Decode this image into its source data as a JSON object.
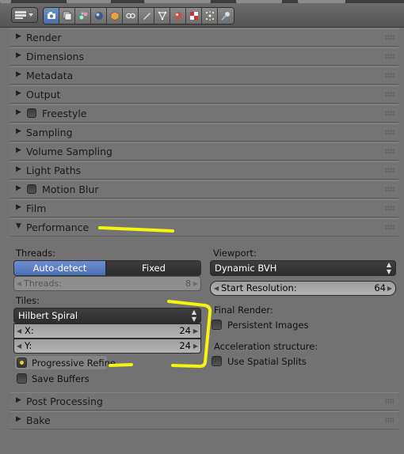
{
  "header": {
    "editor_type_icon": "properties-editor-icon",
    "context_tabs": [
      {
        "icon": "render-icon",
        "active": true
      },
      {
        "icon": "render-layers-icon",
        "active": false
      },
      {
        "icon": "scene-icon",
        "active": false
      },
      {
        "icon": "world-icon",
        "active": false
      },
      {
        "icon": "object-icon",
        "active": false
      },
      {
        "icon": "constraints-icon",
        "active": false
      },
      {
        "icon": "modifiers-icon",
        "active": false
      },
      {
        "icon": "object-data-icon",
        "active": false
      },
      {
        "icon": "material-icon",
        "active": false
      },
      {
        "icon": "texture-icon",
        "active": false
      },
      {
        "icon": "particles-icon",
        "active": false
      },
      {
        "icon": "physics-icon",
        "active": false
      }
    ]
  },
  "panels_top": [
    {
      "title": "Render",
      "checkbox": false
    },
    {
      "title": "Dimensions",
      "checkbox": false
    },
    {
      "title": "Metadata",
      "checkbox": false
    },
    {
      "title": "Output",
      "checkbox": false
    },
    {
      "title": "Freestyle",
      "checkbox": true
    },
    {
      "title": "Sampling",
      "checkbox": false
    },
    {
      "title": "Volume Sampling",
      "checkbox": false
    },
    {
      "title": "Light Paths",
      "checkbox": false
    },
    {
      "title": "Motion Blur",
      "checkbox": true
    },
    {
      "title": "Film",
      "checkbox": false
    }
  ],
  "performance": {
    "title": "Performance",
    "threads_label": "Threads:",
    "threads_mode_auto": "Auto-detect",
    "threads_mode_fixed": "Fixed",
    "threads_count_label": "Threads:",
    "threads_count_value": "8",
    "tiles_label": "Tiles:",
    "tile_order": "Hilbert Spiral",
    "tile_x_label": "X:",
    "tile_x_value": "24",
    "tile_y_label": "Y:",
    "tile_y_value": "24",
    "progressive_refine_label": "Progressive Refine",
    "progressive_refine_checked": true,
    "save_buffers_label": "Save Buffers",
    "save_buffers_checked": false,
    "viewport_label": "Viewport:",
    "viewport_bvh": "Dynamic BVH",
    "start_resolution_label": "Start Resolution:",
    "start_resolution_value": "64",
    "final_render_label": "Final Render:",
    "persistent_images_label": "Persistent Images",
    "acceleration_label": "Acceleration structure:",
    "spatial_splits_label": "Use Spatial Splits"
  },
  "panels_bottom": [
    {
      "title": "Post Processing"
    },
    {
      "title": "Bake"
    }
  ],
  "colors": {
    "accent_blue": "#5a7dc2",
    "annotation_yellow": "#f4f40f",
    "background": "#727272"
  }
}
